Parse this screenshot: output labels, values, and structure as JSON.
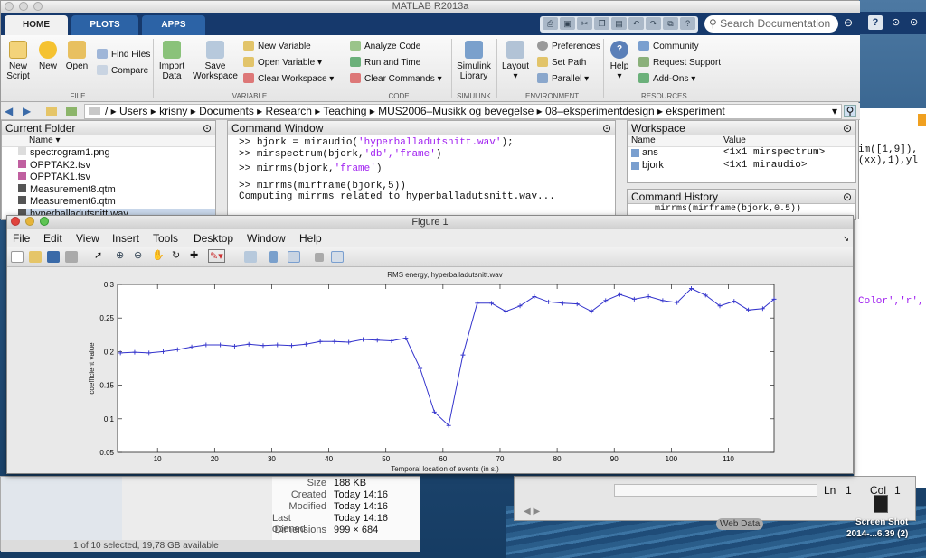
{
  "window": {
    "title": "MATLAB R2013a"
  },
  "tabs": [
    "HOME",
    "PLOTS",
    "APPS"
  ],
  "search": {
    "placeholder": "Search Documentation"
  },
  "ribbon": {
    "file": {
      "new_script": "New\nScript",
      "new": "New",
      "open": "Open",
      "find_files": "Find Files",
      "compare": "Compare",
      "label": "FILE"
    },
    "variable": {
      "import_data": "Import\nData",
      "save_workspace": "Save\nWorkspace",
      "new_variable": "New Variable",
      "open_variable": "Open Variable",
      "clear_workspace": "Clear Workspace",
      "label": "VARIABLE"
    },
    "code": {
      "analyze_code": "Analyze Code",
      "run_and_time": "Run and Time",
      "clear_commands": "Clear Commands",
      "label": "CODE"
    },
    "simulink": {
      "library": "Simulink\nLibrary",
      "label": "SIMULINK"
    },
    "environment": {
      "layout": "Layout",
      "preferences": "Preferences",
      "set_path": "Set Path",
      "parallel": "Parallel",
      "label": "ENVIRONMENT"
    },
    "resources": {
      "help": "Help",
      "community": "Community",
      "request_support": "Request Support",
      "add_ons": "Add-Ons",
      "label": "RESOURCES"
    }
  },
  "address": {
    "path": [
      "/",
      "Users",
      "krisny",
      "Documents",
      "Research",
      "Teaching",
      "MUS2006–Musikk og bevegelse",
      "08–eksperimentdesign",
      "eksperiment"
    ]
  },
  "current_folder": {
    "title": "Current Folder",
    "column": "Name",
    "files": [
      "spectrogram1.png",
      "OPPTAK2.tsv",
      "OPPTAK1.tsv",
      "Measurement8.qtm",
      "Measurement6.qtm",
      "hyperballadutsnitt.wav"
    ]
  },
  "command_window": {
    "title": "Command Window",
    "lines": [
      {
        "prompt": ">> ",
        "pre": "bjork = miraudio(",
        "str": "'hyperballadutsnitt.wav'",
        "post": ");"
      },
      {
        "prompt": ">> ",
        "pre": "mirspectrum(bjork,",
        "str": "'db','frame'",
        "post": ")"
      },
      {
        "prompt": ">> ",
        "pre": "mirrms(bjork,",
        "str": "'frame'",
        "post": ")"
      },
      {
        "prompt": ">> ",
        "pre": "mirrms(mirframe(bjork,5))",
        "str": "",
        "post": ""
      },
      {
        "prompt": "",
        "pre": "Computing mirrms related to hyperballadutsnitt.wav...",
        "str": "",
        "post": ""
      }
    ]
  },
  "workspace": {
    "title": "Workspace",
    "col_name": "Name",
    "col_value": "Value",
    "rows": [
      {
        "name": "ans",
        "value": "<1x1 mirspectrum>"
      },
      {
        "name": "bjork",
        "value": "<1x1 miraudio>"
      }
    ]
  },
  "command_history": {
    "title": "Command History",
    "partial": "mirrms(mirframe(bjork,0.5))"
  },
  "editor_fragments": [
    "im([1,9]),",
    "(xx),1),yl",
    "Color','r',"
  ],
  "figure": {
    "title": "Figure 1",
    "menu": [
      "File",
      "Edit",
      "View",
      "Insert",
      "Tools",
      "Desktop",
      "Window",
      "Help"
    ]
  },
  "chart_data": {
    "type": "line",
    "title": "RMS energy, hyperballadutsnitt.wav",
    "xlabel": "Temporal location of events (in s.)",
    "ylabel": "coefficient value",
    "xlim": [
      3,
      118
    ],
    "ylim": [
      0.05,
      0.3
    ],
    "xticks": [
      10,
      20,
      30,
      40,
      50,
      60,
      70,
      80,
      90,
      100,
      110
    ],
    "yticks": [
      0.05,
      0.1,
      0.15,
      0.2,
      0.25,
      0.3
    ],
    "color": "#3333cc",
    "x": [
      3.5,
      6,
      8.5,
      11,
      13.5,
      16,
      18.5,
      21,
      23.5,
      26,
      28.5,
      31,
      33.5,
      36,
      38.5,
      41,
      43.5,
      46,
      48.5,
      51,
      53.5,
      56,
      58.5,
      61,
      63.5,
      66,
      68.5,
      71,
      73.5,
      76,
      78.5,
      81,
      83.5,
      86,
      88.5,
      91,
      93.5,
      96,
      98.5,
      101,
      103.5,
      106,
      108.5,
      111,
      113.5,
      116,
      118
    ],
    "y": [
      0.198,
      0.199,
      0.198,
      0.2,
      0.203,
      0.207,
      0.21,
      0.21,
      0.208,
      0.211,
      0.209,
      0.21,
      0.209,
      0.211,
      0.215,
      0.215,
      0.214,
      0.218,
      0.217,
      0.216,
      0.22,
      0.175,
      0.11,
      0.09,
      0.195,
      0.272,
      0.272,
      0.26,
      0.268,
      0.282,
      0.274,
      0.272,
      0.271,
      0.26,
      0.276,
      0.285,
      0.278,
      0.282,
      0.276,
      0.273,
      0.294,
      0.284,
      0.268,
      0.275,
      0.262,
      0.264,
      0.278,
      0.265
    ]
  },
  "finder": {
    "size_label": "Size",
    "size": "188 KB",
    "created_label": "Created",
    "created": "Today 14:16",
    "modified_label": "Modified",
    "modified": "Today 14:16",
    "opened_label": "Last opened",
    "opened": "Today 14:16",
    "dims_label": "Dimensions",
    "dims": "999 × 684",
    "status": "1 of 10 selected, 19,78 GB available"
  },
  "editor_status": {
    "ln_label": "Ln",
    "ln": "1",
    "col_label": "Col",
    "col": "1"
  },
  "desktop": {
    "web_data": "Web Data",
    "screenshot_label": "Screen Shot",
    "screenshot_date": "2014-...6.39 (2)"
  }
}
